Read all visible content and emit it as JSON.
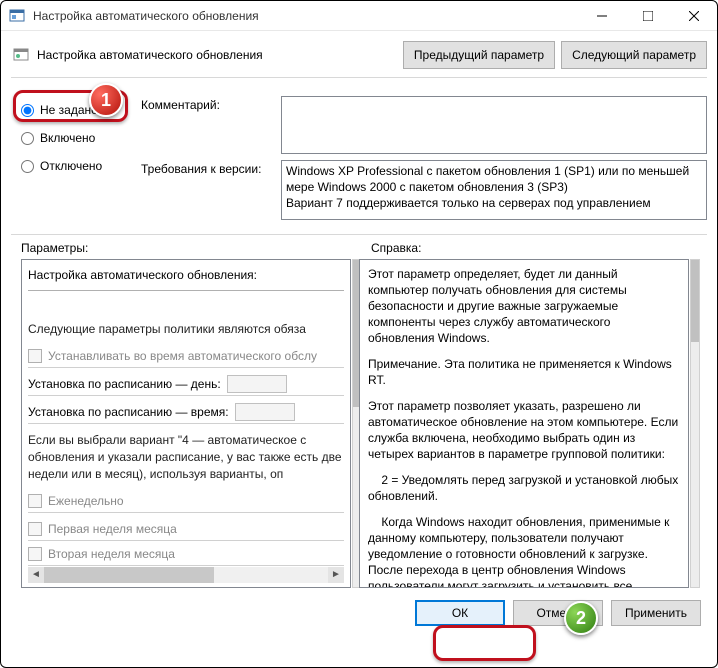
{
  "window": {
    "title": "Настройка автоматического обновления"
  },
  "toolbar": {
    "heading": "Настройка автоматического обновления",
    "prev": "Предыдущий параметр",
    "next": "Следующий параметр"
  },
  "radios": {
    "not_configured": "Не задано",
    "enabled": "Включено",
    "disabled": "Отключено"
  },
  "fields": {
    "comment": "Комментарий:",
    "requirements": "Требования к версии:",
    "requirements_text": "Windows XP Professional с пакетом обновления 1 (SP1) или по меньшей мере Windows 2000 с пакетом обновления 3 (SP3)\nВариант 7 поддерживается только на серверах под управлением"
  },
  "sections": {
    "options": "Параметры:",
    "help": "Справка:"
  },
  "options": {
    "head": "Настройка автоматического обновления:",
    "required": "Следующие параметры политики являются обяза",
    "install_maint": "Устанавливать во время автоматического обслу",
    "sched_day": "Установка по расписанию — день:",
    "sched_time": "Установка по расписанию — время:",
    "variant4": "Если вы выбрали вариант \"4 — автоматическое с обновления и указали расписание, у вас также есть две недели или в месяц), используя варианты, oп",
    "weekly": "Еженедельно",
    "first_week": "Первая неделя месяца",
    "second_week": "Вторая неделя месяца"
  },
  "help": {
    "p1": "Этот параметр определяет, будет ли данный компьютер получать обновления для системы безопасности и другие важные загружаемые компоненты через службу автоматического обновления Windows.",
    "p2": "Примечание. Эта политика не применяется к Windows RT.",
    "p3": "Этот параметр позволяет указать, разрешено ли автоматическое обновление на этом компьютере. Если служба включена, необходимо выбрать один из четырех вариантов в параметре групповой политики:",
    "p4": "    2 = Уведомлять перед загрузкой и установкой любых обновлений.",
    "p5": "    Когда Windows находит обновления, применимые к данному компьютеру, пользователи получают уведомление о готовности обновлений к загрузке. После перехода в центр обновления Windows пользователи могут загрузить и установить все доступные обнов"
  },
  "buttons": {
    "ok": "ОК",
    "cancel": "Отмена",
    "apply": "Применить"
  },
  "badges": {
    "b1": "1",
    "b2": "2"
  }
}
